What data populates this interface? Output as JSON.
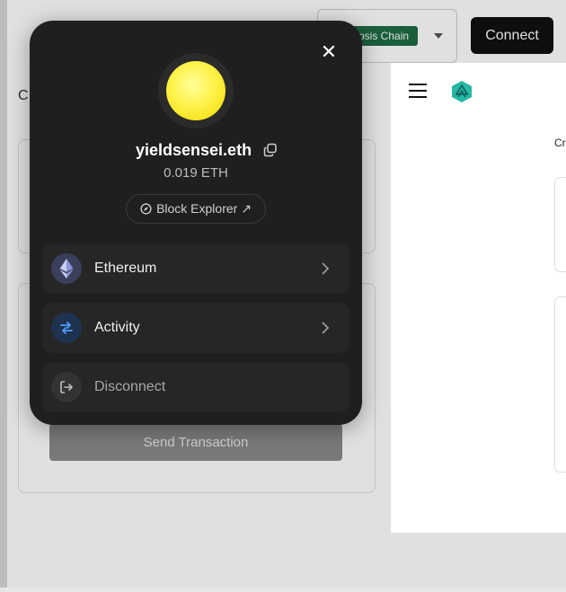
{
  "background": {
    "letter_left": "C",
    "send_button_label": "Send Transaction",
    "chain_badge": "osis Chain",
    "connect_label": "Connect",
    "inner_letter": "Cr"
  },
  "modal": {
    "close_symbol": "✕",
    "ens_name": "yieldsensei.eth",
    "balance": "0.019 ETH",
    "explorer_label": "Block Explorer ↗",
    "items": [
      {
        "label": "Ethereum",
        "icon": "ethereum-icon"
      },
      {
        "label": "Activity",
        "icon": "activity-swap-icon"
      },
      {
        "label": "Disconnect",
        "icon": "disconnect-icon"
      }
    ]
  },
  "colors": {
    "modal_bg": "#1f1f1f",
    "menu_item_bg": "#262626",
    "chain_badge_bg": "#1f6b45",
    "accent_blue": "#3b82f6",
    "logo_teal": "#23b7a4",
    "avatar_yellow": "#fff24a"
  }
}
